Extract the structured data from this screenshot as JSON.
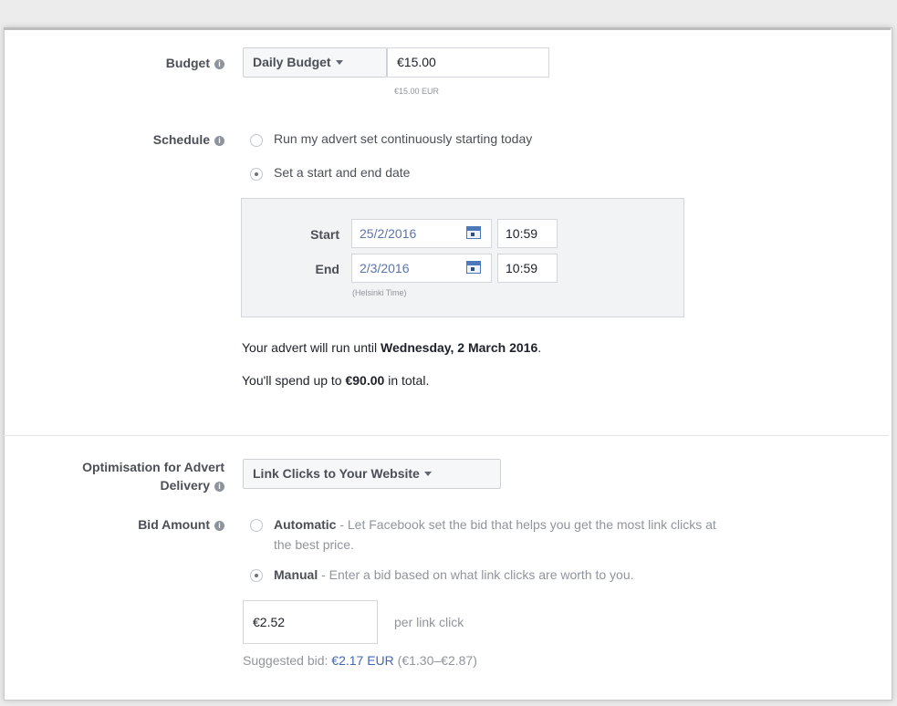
{
  "budget": {
    "label": "Budget",
    "type_button": "Daily Budget",
    "amount": "€15.00",
    "amount_hint": "€15.00 EUR"
  },
  "schedule": {
    "label": "Schedule",
    "option_continuous": "Run my advert set continuously starting today",
    "option_start_end": "Set a start and end date",
    "selected": "start_end",
    "start_label": "Start",
    "start_date": "25/2/2016",
    "start_time": "10:59",
    "end_label": "End",
    "end_date": "2/3/2016",
    "end_time": "10:59",
    "timezone": "(Helsinki Time)",
    "run_until_prefix": "Your advert will run until ",
    "run_until_date": "Wednesday, 2 March 2016",
    "run_until_suffix": ".",
    "spend_prefix": "You'll spend up to ",
    "spend_amount": "€90.00",
    "spend_suffix": " in total."
  },
  "optimisation": {
    "label_line1": "Optimisation for Advert",
    "label_line2": "Delivery",
    "selected": "Link Clicks to Your Website"
  },
  "bid": {
    "label": "Bid Amount",
    "automatic_title": "Automatic",
    "automatic_desc_line1": " - Let Facebook set the bid that helps you get the most link clicks at",
    "automatic_desc_line2": "the best price.",
    "manual_title": "Manual",
    "manual_desc": " - Enter a bid based on what link clicks are worth to you.",
    "selected": "manual",
    "amount": "€2.52",
    "unit": "per link click",
    "suggested_prefix": "Suggested bid: ",
    "suggested_value": "€2.17 EUR",
    "suggested_range": " (€1.30–€2.87)"
  },
  "icons": {
    "info": "info-icon",
    "caret": "chevron-down-icon",
    "calendar": "calendar-icon"
  },
  "colors": {
    "link": "#4267b2",
    "date_text": "#5b74a8",
    "panel": "#f2f3f5"
  }
}
